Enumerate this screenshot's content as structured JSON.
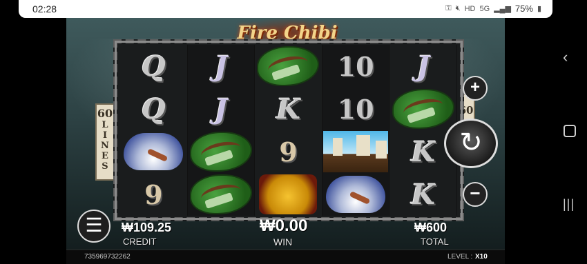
{
  "status_bar": {
    "time": "02:28",
    "icons": [
      "key-icon",
      "mute-icon",
      "hd-voice-icon",
      "5g-icon",
      "signal-icon"
    ],
    "battery": "75%"
  },
  "game": {
    "title": "Fire Chibi",
    "lines_left_number": "60",
    "lines_left_word": "LINES",
    "lines_right_number": "60",
    "reels": [
      [
        "Q",
        "J",
        "bow",
        "10",
        "J"
      ],
      [
        "Q",
        "J",
        "K",
        "10",
        "bow"
      ],
      [
        "fan",
        "bow",
        "9",
        "ship",
        "K"
      ],
      [
        "9",
        "bow",
        "lion",
        "fan",
        "K"
      ]
    ],
    "credit_value": "₩109.25",
    "credit_label": "CREDIT",
    "win_value": "₩0.00",
    "win_label": "WIN",
    "total_value": "₩600",
    "total_label": "TOTAL",
    "session_id": "735969732262",
    "level_label": "LEVEL :",
    "level_value": "X10",
    "colors": {
      "title": "#f2d48a",
      "chain": "#8b8b8b",
      "tag": "#e6ddc7"
    }
  },
  "nav": {
    "back": "back-icon",
    "home": "home-icon",
    "recents": "recents-icon"
  }
}
